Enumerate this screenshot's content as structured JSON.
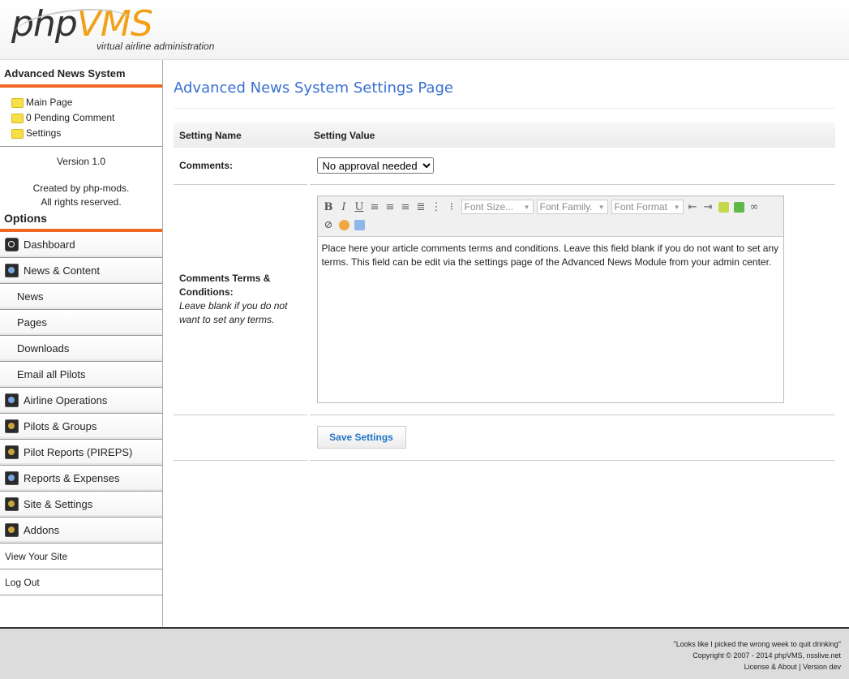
{
  "header": {
    "logo_php": "php",
    "logo_vms": "VMS",
    "tagline": "virtual airline administration"
  },
  "sidebar": {
    "module_title": "Advanced News System",
    "links": [
      {
        "label": "Main Page"
      },
      {
        "label": "0 Pending Comment"
      },
      {
        "label": "Settings"
      }
    ],
    "version": "Version 1.0",
    "created_by_prefix": "Created by ",
    "created_by_author": "php-mods",
    "created_by_suffix": ".",
    "rights": "All rights reserved.",
    "options_title": "Options",
    "menu": [
      {
        "label": "Dashboard",
        "icon": "dashboard-icon"
      },
      {
        "label": "News & Content",
        "icon": "news-content-icon"
      },
      {
        "label": "News",
        "sub": true
      },
      {
        "label": "Pages",
        "sub": true
      },
      {
        "label": "Downloads",
        "sub": true
      },
      {
        "label": "Email all Pilots",
        "sub": true
      },
      {
        "label": "Airline Operations",
        "icon": "airline-operations-icon"
      },
      {
        "label": "Pilots & Groups",
        "icon": "pilots-groups-icon"
      },
      {
        "label": "Pilot Reports (PIREPS)",
        "icon": "pilot-reports-icon"
      },
      {
        "label": "Reports & Expenses",
        "icon": "reports-expenses-icon"
      },
      {
        "label": "Site & Settings",
        "icon": "site-settings-icon"
      },
      {
        "label": "Addons",
        "icon": "addons-icon"
      },
      {
        "label": "View Your Site"
      },
      {
        "label": "Log Out"
      }
    ]
  },
  "main": {
    "title": "Advanced News System Settings Page",
    "col_name": "Setting Name",
    "col_value": "Setting Value",
    "comments_label": "Comments:",
    "comments_value": "No approval needed",
    "terms_label": "Comments Terms & Conditions:",
    "terms_hint": "Leave blank if you do not want to set any terms.",
    "editor": {
      "font_size": "Font Size...",
      "font_family": "Font Family.",
      "font_format": "Font Format",
      "content": "Place here your article comments terms and conditions. Leave this field blank if you do not want to set any terms. This field can be edit via the settings page of the Advanced News Module from your admin center."
    },
    "save_label": "Save Settings"
  },
  "footer": {
    "quote": "\"Looks like I picked the wrong week to quit drinking\"",
    "copyright": "Copyright © 2007 - 2014 phpVMS, nsslive.net",
    "license": "License & About",
    "sep": " | ",
    "version": "Version dev"
  }
}
